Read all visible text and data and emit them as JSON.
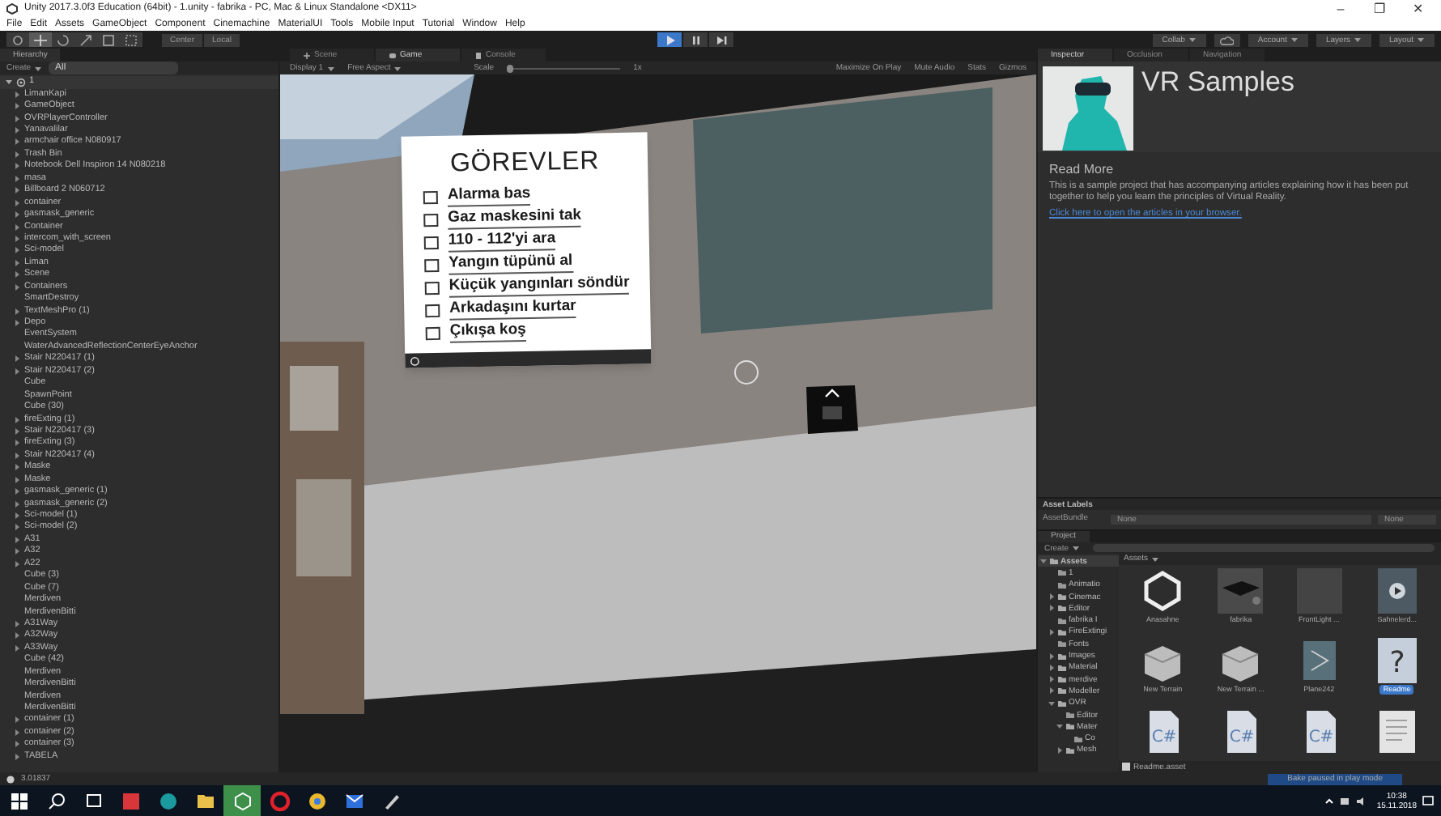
{
  "window": {
    "title": "Unity 2017.3.0f3 Education (64bit) - 1.unity - fabrika - PC, Mac & Linux Standalone <DX11>",
    "controls": [
      "–",
      "❐",
      "✕"
    ]
  },
  "menu": [
    "File",
    "Edit",
    "Assets",
    "GameObject",
    "Component",
    "Cinemachine",
    "MaterialUI",
    "Tools",
    "Mobile Input",
    "Tutorial",
    "Window",
    "Help"
  ],
  "toolbar": {
    "tools": [
      {
        "kind": "hand",
        "selected": false
      },
      {
        "kind": "move",
        "selected": true
      },
      {
        "kind": "rotate",
        "selected": false
      },
      {
        "kind": "scale",
        "selected": false
      },
      {
        "kind": "rect",
        "selected": false
      },
      {
        "kind": "transform",
        "selected": false
      }
    ],
    "pivot": [
      "Center",
      "Local"
    ],
    "play": [
      {
        "kind": "play",
        "on": true
      },
      {
        "kind": "pause",
        "on": false
      },
      {
        "kind": "step",
        "on": false
      }
    ],
    "right": [
      {
        "kind": "dropdown",
        "label": "Collab"
      },
      {
        "kind": "cloud"
      },
      {
        "kind": "dropdown",
        "label": "Account"
      },
      {
        "kind": "dropdown",
        "label": "Layers"
      },
      {
        "kind": "dropdown",
        "label": "Layout"
      }
    ]
  },
  "hierarchy": {
    "tab": "Hierarchy",
    "create": "Create",
    "search_placeholder": "All",
    "root": {
      "label": "1",
      "expanded": true,
      "children": [
        {
          "label": "LimanKapi",
          "kind": "collapsed"
        },
        {
          "label": "GameObject",
          "kind": "collapsed"
        },
        {
          "label": "OVRPlayerController",
          "kind": "collapsed"
        },
        {
          "label": "Yanavalilar",
          "kind": "collapsed"
        },
        {
          "label": "armchair office N080917",
          "kind": "collapsed"
        },
        {
          "label": "Trash Bin",
          "kind": "collapsed"
        },
        {
          "label": "Notebook Dell Inspiron 14 N080218",
          "kind": "collapsed"
        },
        {
          "label": "masa",
          "kind": "collapsed"
        },
        {
          "label": "Billboard 2 N060712",
          "kind": "collapsed"
        },
        {
          "label": "container",
          "kind": "collapsed"
        },
        {
          "label": "gasmask_generic",
          "kind": "collapsed"
        },
        {
          "label": "Container",
          "kind": "collapsed"
        },
        {
          "label": "intercom_with_screen",
          "kind": "collapsed"
        },
        {
          "label": "Sci-model",
          "kind": "collapsed"
        },
        {
          "label": "Liman",
          "kind": "collapsed"
        },
        {
          "label": "Scene",
          "kind": "collapsed"
        },
        {
          "label": "Containers",
          "kind": "collapsed"
        },
        {
          "label": "SmartDestroy",
          "kind": "leaf"
        },
        {
          "label": "TextMeshPro (1)",
          "kind": "collapsed"
        },
        {
          "label": "Depo",
          "kind": "collapsed"
        },
        {
          "label": "EventSystem",
          "kind": "leaf"
        },
        {
          "label": "WaterAdvancedReflectionCenterEyeAnchor",
          "kind": "leaf"
        },
        {
          "label": "Stair N220417 (1)",
          "kind": "collapsed"
        },
        {
          "label": "Stair N220417 (2)",
          "kind": "collapsed"
        },
        {
          "label": "Cube",
          "kind": "leaf"
        },
        {
          "label": "SpawnPoint",
          "kind": "leaf"
        },
        {
          "label": "Cube (30)",
          "kind": "leaf"
        },
        {
          "label": "fireExting (1)",
          "kind": "collapsed"
        },
        {
          "label": "Stair N220417 (3)",
          "kind": "collapsed"
        },
        {
          "label": "fireExting (3)",
          "kind": "collapsed"
        },
        {
          "label": "Stair N220417 (4)",
          "kind": "collapsed"
        },
        {
          "label": "Maske",
          "kind": "collapsed"
        },
        {
          "label": "Maske",
          "kind": "collapsed"
        },
        {
          "label": "gasmask_generic (1)",
          "kind": "collapsed"
        },
        {
          "label": "gasmask_generic (2)",
          "kind": "collapsed"
        },
        {
          "label": "Sci-model (1)",
          "kind": "collapsed"
        },
        {
          "label": "Sci-model (2)",
          "kind": "collapsed"
        },
        {
          "label": "A31",
          "kind": "collapsed"
        },
        {
          "label": "A32",
          "kind": "collapsed"
        },
        {
          "label": "A22",
          "kind": "collapsed"
        },
        {
          "label": "Cube (3)",
          "kind": "leaf"
        },
        {
          "label": "Cube (7)",
          "kind": "leaf"
        },
        {
          "label": "Merdiven",
          "kind": "leaf"
        },
        {
          "label": "MerdivenBitti",
          "kind": "leaf"
        },
        {
          "label": "A31Way",
          "kind": "collapsed"
        },
        {
          "label": "A32Way",
          "kind": "collapsed"
        },
        {
          "label": "A33Way",
          "kind": "collapsed"
        },
        {
          "label": "Cube (42)",
          "kind": "leaf"
        },
        {
          "label": "Merdiven",
          "kind": "leaf"
        },
        {
          "label": "MerdivenBitti",
          "kind": "leaf"
        },
        {
          "label": "Merdiven",
          "kind": "leaf"
        },
        {
          "label": "MerdivenBitti",
          "kind": "leaf"
        },
        {
          "label": "container (1)",
          "kind": "collapsed"
        },
        {
          "label": "container (2)",
          "kind": "collapsed"
        },
        {
          "label": "container (3)",
          "kind": "collapsed"
        },
        {
          "label": "TABELA",
          "kind": "collapsed"
        }
      ]
    }
  },
  "center": {
    "tabs": [
      {
        "label": "Scene",
        "kind": "scene",
        "selected": false
      },
      {
        "label": "Game",
        "kind": "game",
        "selected": true
      },
      {
        "label": "Console",
        "kind": "console",
        "selected": false
      }
    ],
    "display": "Display 1",
    "aspect": "Free Aspect",
    "scale_label": "Scale",
    "scale_value": "1x",
    "options": [
      "Maximize On Play",
      "Mute Audio",
      "Stats",
      "Gizmos"
    ],
    "board": {
      "title": "GÖREVLER",
      "tasks": [
        {
          "label": "Alarma bas",
          "checked": false
        },
        {
          "label": "Gaz maskesini tak",
          "checked": false
        },
        {
          "label": "110 - 112'yi ara",
          "checked": false
        },
        {
          "label": "Yangın tüpünü al",
          "checked": false
        },
        {
          "label": "Küçük yangınları söndür",
          "checked": false
        },
        {
          "label": "Arkadaşını kurtar",
          "checked": false
        },
        {
          "label": "Çıkışa koş",
          "checked": false
        }
      ]
    }
  },
  "inspector": {
    "tabs": [
      {
        "label": "Inspector",
        "selected": true
      },
      {
        "label": "Occlusion",
        "selected": false
      },
      {
        "label": "Navigation",
        "selected": false
      }
    ],
    "title": "VR Samples",
    "heading": "Read More",
    "text": "This is a sample project that has accompanying articles explaining how it has been put together to help you learn the principles of Virtual Reality.",
    "link": "Click here to open the articles in your browser.",
    "asset_labels": "Asset Labels",
    "assetbundle_label": "AssetBundle",
    "assetbundle": "None",
    "variant": "None"
  },
  "project": {
    "tab": "Project",
    "create": "Create",
    "tree": [
      {
        "label": "Assets",
        "kind": "expanded",
        "children": [
          {
            "label": "1",
            "kind": "leaf"
          },
          {
            "label": "Animatio",
            "kind": "leaf"
          },
          {
            "label": "Cinemac",
            "kind": "collapsed"
          },
          {
            "label": "Editor",
            "kind": "collapsed"
          },
          {
            "label": "fabrika I",
            "kind": "leaf"
          },
          {
            "label": "FireExtingi",
            "kind": "collapsed"
          },
          {
            "label": "Fonts",
            "kind": "leaf"
          },
          {
            "label": "Images",
            "kind": "collapsed"
          },
          {
            "label": "Material",
            "kind": "collapsed"
          },
          {
            "label": "merdive",
            "kind": "collapsed"
          },
          {
            "label": "Modeller",
            "kind": "collapsed"
          },
          {
            "label": "OVR",
            "kind": "expanded",
            "children": [
              {
                "label": "Editor",
                "kind": "leaf"
              },
              {
                "label": "Mater",
                "kind": "expanded",
                "children": [
                  {
                    "label": "Co",
                    "kind": "leaf"
                  }
                ]
              },
              {
                "label": "Mesh",
                "kind": "collapsed"
              }
            ]
          }
        ]
      }
    ],
    "breadcrumb": "Assets",
    "assets": [
      {
        "label": "Anasahne",
        "kind": "unity",
        "selected": false
      },
      {
        "label": "fabrika",
        "kind": "model",
        "selected": false
      },
      {
        "label": "FrontLight ...",
        "kind": "material",
        "selected": false
      },
      {
        "label": "Sahnelerd...",
        "kind": "video",
        "selected": false
      },
      {
        "label": "New Terrain",
        "kind": "terrain",
        "selected": false
      },
      {
        "label": "New Terrain ...",
        "kind": "terrain",
        "selected": false
      },
      {
        "label": "Plane242",
        "kind": "prefab",
        "selected": false
      },
      {
        "label": "Readme",
        "kind": "unknown",
        "glyph": "?",
        "selected": true
      },
      {
        "kind": "script",
        "glyph": "C#"
      },
      {
        "kind": "script",
        "glyph": "C#"
      },
      {
        "kind": "script",
        "glyph": "C#"
      },
      {
        "kind": "document"
      }
    ],
    "path": "Readme.asset"
  },
  "status": {
    "message": "3.01837",
    "lighting": "Bake paused in play mode"
  },
  "taskbar": {
    "apps": [
      {
        "kind": "windows"
      },
      {
        "kind": "search"
      },
      {
        "kind": "taskview"
      },
      {
        "kind": "red"
      },
      {
        "kind": "circle"
      },
      {
        "kind": "folder"
      },
      {
        "kind": "unity",
        "selected": true
      },
      {
        "kind": "opera"
      },
      {
        "kind": "chrome"
      },
      {
        "kind": "mail"
      },
      {
        "kind": "paint"
      }
    ],
    "time": "10:38",
    "date": "15.11.2018"
  }
}
